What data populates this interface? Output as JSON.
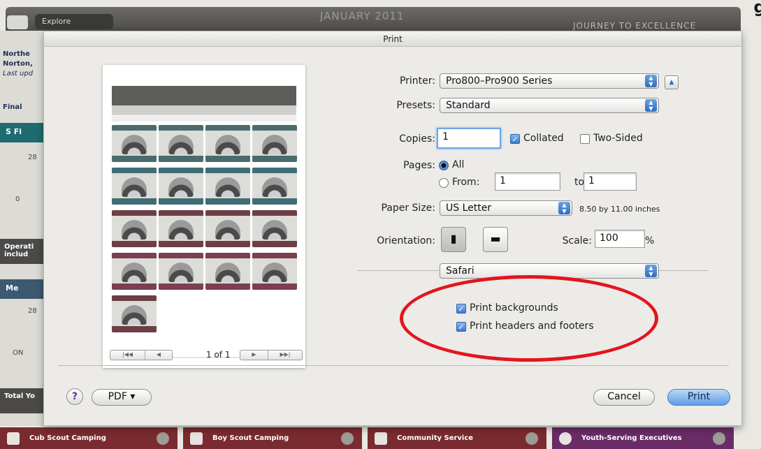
{
  "background": {
    "top_button": "Explore",
    "month": "JANUARY 2011",
    "brand": "JOURNEY TO EXCELLENCE",
    "corner_text": "gry",
    "left_items": [
      "Northe",
      "Norton,",
      "Last upd",
      "Final",
      "S Fi",
      "28",
      "0",
      "Operati",
      "includ",
      "Me",
      "28",
      "ON",
      "Total Yo"
    ],
    "bottom_tabs": [
      "Cub Scout Camping",
      "Boy Scout Camping",
      "Community Service",
      "Youth-Serving Executives"
    ],
    "bottom_colors": [
      "#7a2b2f",
      "#7a2b2f",
      "#7a2b2f",
      "#6a2c67"
    ]
  },
  "dialog": {
    "title": "Print",
    "printer_label": "Printer:",
    "printer_value": "Pro800–Pro900 Series",
    "presets_label": "Presets:",
    "presets_value": "Standard",
    "copies_label": "Copies:",
    "copies_value": "1",
    "collated_label": "Collated",
    "collated_checked": true,
    "two_sided_label": "Two-Sided",
    "two_sided_checked": false,
    "pages_label": "Pages:",
    "pages_all_label": "All",
    "pages_from_label": "From:",
    "pages_from_value": "1",
    "pages_to_label": "to:",
    "pages_to_value": "1",
    "paper_size_label": "Paper Size:",
    "paper_size_value": "US Letter",
    "paper_size_detail": "8.50 by 11.00 inches",
    "orientation_label": "Orientation:",
    "scale_label": "Scale:",
    "scale_value": "100",
    "scale_unit": "%",
    "panel_value": "Safari",
    "print_backgrounds_label": "Print backgrounds",
    "print_backgrounds_checked": true,
    "print_headers_label": "Print headers and footers",
    "print_headers_checked": true,
    "page_count": "1 of 1",
    "pdf_label": "PDF ▾",
    "help_label": "?",
    "cancel_label": "Cancel",
    "print_label": "Print"
  },
  "colors": {
    "highlight_ellipse": "#e2161c",
    "accent_blue": "#3a7ad0"
  }
}
